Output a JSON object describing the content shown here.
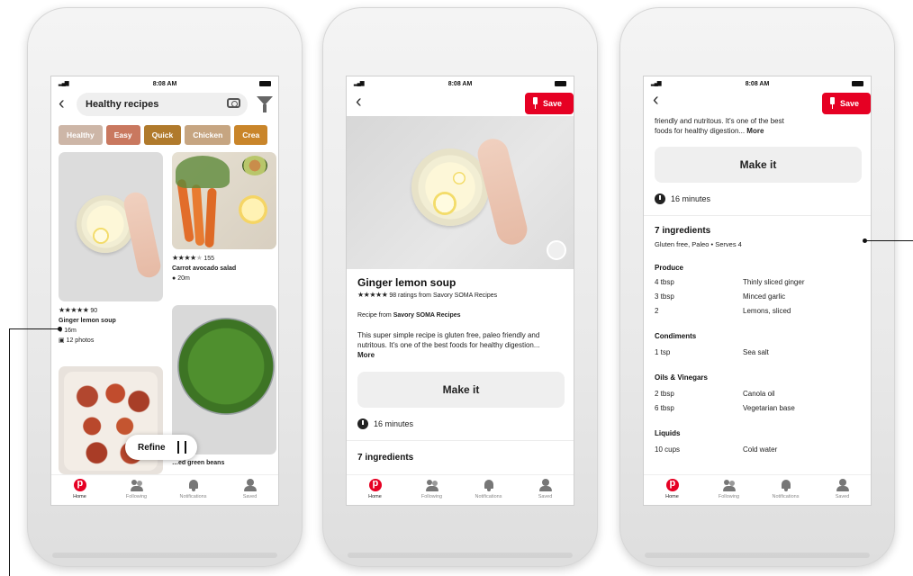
{
  "status": {
    "time": "8:08 AM"
  },
  "phone1": {
    "search": {
      "value": "Healthy recipes"
    },
    "chips": [
      {
        "label": "Healthy",
        "color": "#cdb6a7"
      },
      {
        "label": "Easy",
        "color": "#c9785f"
      },
      {
        "label": "Quick",
        "color": "#b07a2c"
      },
      {
        "label": "Chicken",
        "color": "#c6a581"
      },
      {
        "label": "Crea",
        "color": "#c9852a"
      }
    ],
    "pin1": {
      "rating": "★★★★★",
      "count": "90",
      "title": "Ginger lemon soup",
      "time": "16m",
      "photos": "12 photos"
    },
    "pin2": {
      "rating": "★★★★",
      "rating_empty": "★",
      "count": "155",
      "title": "Carrot avocado salad",
      "time": "20m"
    },
    "pin3": {
      "title": "…ed green beans"
    },
    "refine_label": "Refine"
  },
  "phone2": {
    "save_label": "Save",
    "title": "Ginger lemon soup",
    "rating": "★★★★★",
    "ratings_text": "98 ratings from Savory SOMA Recipes",
    "recipe_from_prefix": "Recipe from",
    "recipe_from_source": "Savory SOMA Recipes",
    "description": "This super simple recipe is gluten free, paleo friendly and nutritous. It's one of the best foods for healthy digestion...",
    "more_label": "More",
    "make_it_label": "Make it",
    "duration": "16 minutes",
    "ingredients_heading": "7 ingredients"
  },
  "phone3": {
    "save_label": "Save",
    "description_tail_1": "friendly and nutritous. It's one of the best",
    "description_tail_2": "foods for healthy digestion...",
    "more_label": "More",
    "make_it_label": "Make it",
    "duration": "16 minutes",
    "ingredients_heading": "7 ingredients",
    "ingredients_sub": "Gluten free, Paleo • Serves 4",
    "sections": [
      {
        "name": "Produce",
        "items": [
          [
            "4 tbsp",
            "Thinly sliced ginger"
          ],
          [
            "3 tbsp",
            "Minced garlic"
          ],
          [
            "2",
            "Lemons, sliced"
          ]
        ]
      },
      {
        "name": "Condiments",
        "items": [
          [
            "1 tsp",
            "Sea salt"
          ]
        ]
      },
      {
        "name": "Oils & Vinegars",
        "items": [
          [
            "2 tbsp",
            "Canola oil"
          ],
          [
            "6 tbsp",
            "Vegetarian base"
          ]
        ]
      },
      {
        "name": "Liquids",
        "items": [
          [
            "10 cups",
            "Cold water"
          ]
        ]
      }
    ]
  },
  "tabs": [
    "Home",
    "Following",
    "Notifications",
    "Saved"
  ]
}
